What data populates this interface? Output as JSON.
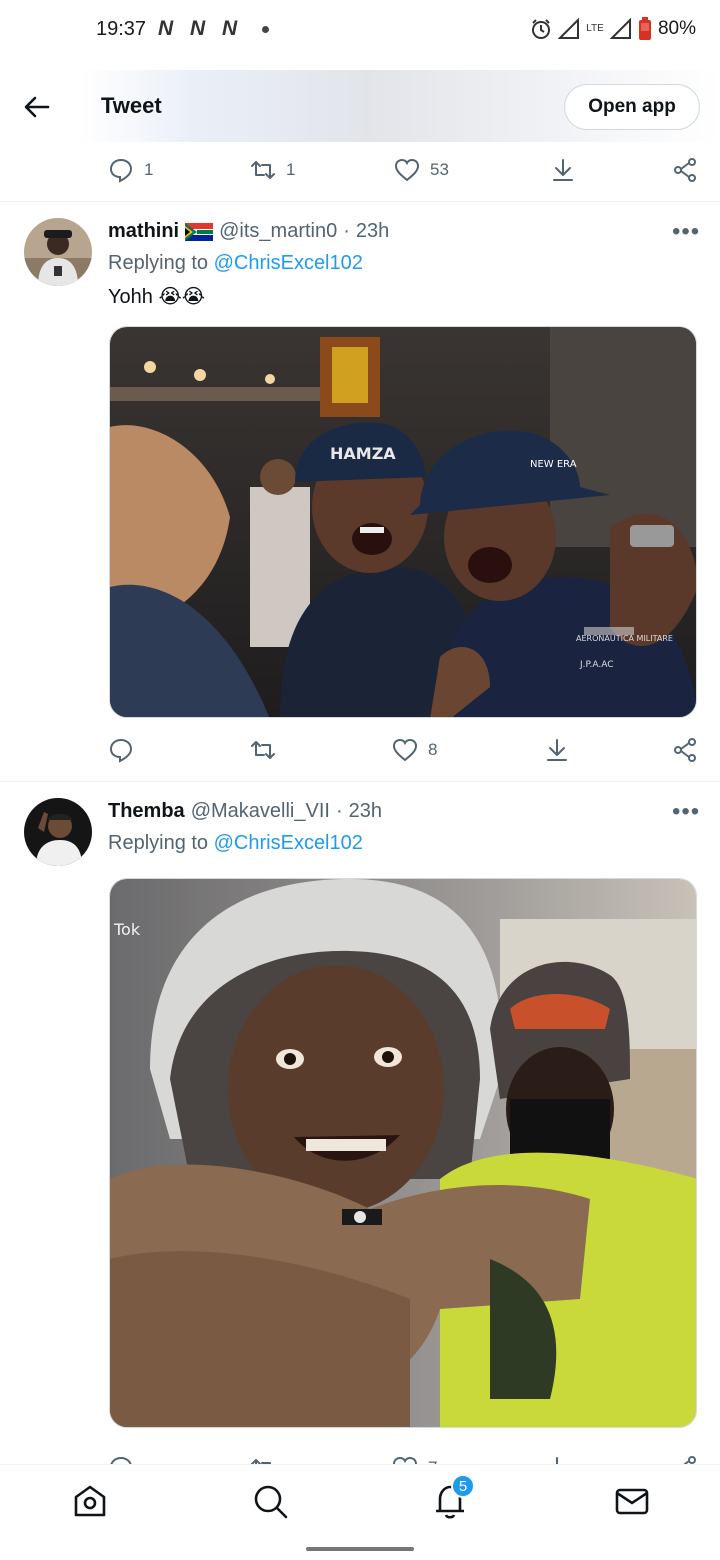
{
  "status_bar": {
    "time": "19:37",
    "network_icons": [
      "N",
      "N",
      "N"
    ],
    "lte_label": "LTE",
    "battery": "80%"
  },
  "header": {
    "title": "Tweet",
    "open_app_label": "Open app"
  },
  "top_actions": {
    "replies": "1",
    "retweets": "1",
    "likes": "53"
  },
  "tweets": [
    {
      "name": "mathini",
      "flag": "south-africa-flag",
      "handle": "@its_martin0",
      "time": "23h",
      "replying_prefix": "Replying to",
      "replying_to": "@ChrisExcel102",
      "text": "Yohh",
      "emojis": "😭😭",
      "media_text": [
        "HAMZA",
        "NEW ERA",
        "AERONAUTICA MILITARE",
        "J.P.A.AC"
      ],
      "actions": {
        "replies": "",
        "retweets": "",
        "likes": "8"
      }
    },
    {
      "name": "Themba",
      "handle": "@Makavelli_VII",
      "time": "23h",
      "replying_prefix": "Replying to",
      "replying_to": "@ChrisExcel102",
      "text": "",
      "media_text": [
        "Tok"
      ],
      "actions": {
        "replies": "",
        "retweets": "",
        "likes": "7"
      }
    }
  ],
  "bottom_nav": {
    "items": [
      "home-icon",
      "search-icon",
      "notifications-icon",
      "messages-icon"
    ],
    "notification_count": "5"
  },
  "colors": {
    "accent": "#1d9bf0",
    "secondary_text": "#536471",
    "primary_text": "#0f1419"
  }
}
